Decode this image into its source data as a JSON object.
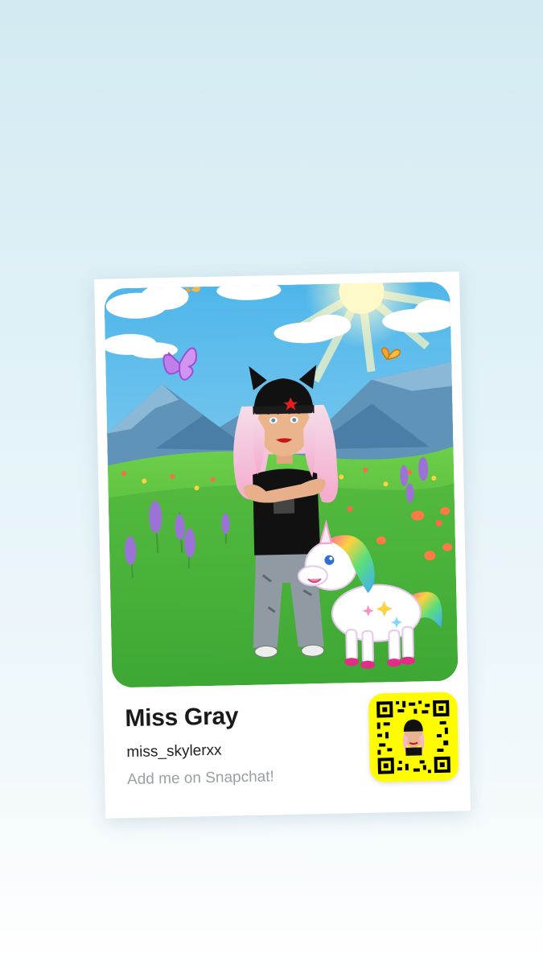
{
  "profile": {
    "display_name": "Miss Gray",
    "username": "miss_skylerxx",
    "cta": "Add me on Snapchat!"
  },
  "snapcode": {
    "icon": "snapcode-qr-icon",
    "background_color": "#FFFC00"
  },
  "scene": {
    "icons": [
      "bitmoji-avatar",
      "unicorn-sticker",
      "butterfly-icon",
      "sun-icon",
      "mountains",
      "lavender-flowers"
    ]
  }
}
